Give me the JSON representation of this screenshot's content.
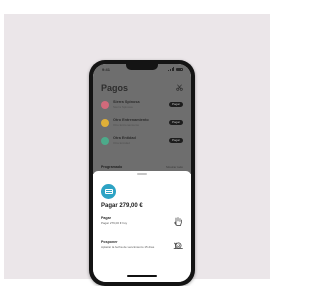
{
  "status_bar": {
    "time": "9:41"
  },
  "screen": {
    "title": "Pagos",
    "title_icon": "scissors-icon",
    "payments": [
      {
        "title": "Sierra Spinosa",
        "subtitle": "Sierra Spinosa",
        "pill": "Pagar",
        "color": "#d16a7b"
      },
      {
        "title": "Otro Entrenamiento",
        "subtitle": "Otro Entrenamiento",
        "pill": "Pagar",
        "color": "#e0b038"
      },
      {
        "title": "Otra Entidad",
        "subtitle": "Otra Entidad",
        "pill": "Pagar",
        "color": "#4caa8a"
      }
    ],
    "section_label": "Programado",
    "section_link": "Mostrar todo"
  },
  "sheet": {
    "badge_icon": "credit-card-icon",
    "title": "Pagar 279,00 €",
    "options": [
      {
        "title": "Pagar",
        "subtitle": "Pagar 279,00 € hoy",
        "icon": "hand-gesture-icon"
      },
      {
        "title": "Posponer",
        "subtitle": "Aplazar la fecha de vencimiento 15 días",
        "icon": "snail-icon"
      }
    ]
  }
}
